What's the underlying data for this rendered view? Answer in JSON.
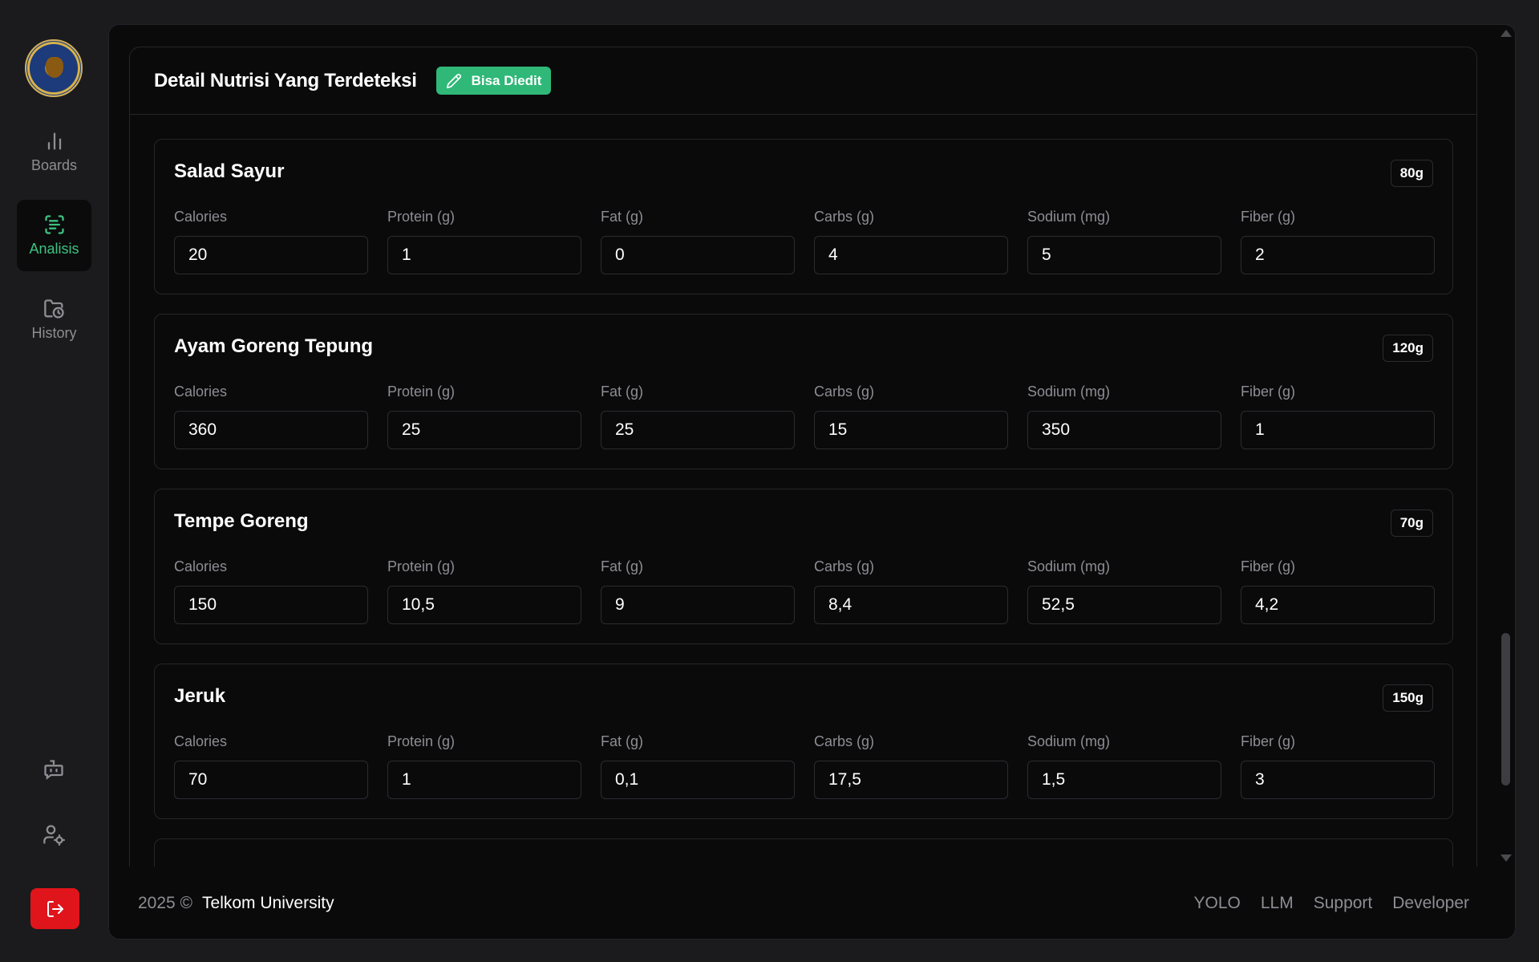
{
  "sidebar": {
    "nav": [
      {
        "label": "Boards",
        "icon": "bar-chart-icon"
      },
      {
        "label": "Analisis",
        "icon": "scan-text-icon"
      },
      {
        "label": "History",
        "icon": "folder-clock-icon"
      }
    ],
    "accent_color": "#3ec27f",
    "logout_color": "#e0151b"
  },
  "card": {
    "title": "Detail Nutrisi Yang Terdeteksi",
    "badge": "Bisa Diedit"
  },
  "labels": {
    "calories": "Calories",
    "protein": "Protein (g)",
    "fat": "Fat (g)",
    "carbs": "Carbs (g)",
    "sodium": "Sodium (mg)",
    "fiber": "Fiber (g)"
  },
  "foods": [
    {
      "name": "Salad Sayur",
      "weight": "80g",
      "calories": "20",
      "protein": "1",
      "fat": "0",
      "carbs": "4",
      "sodium": "5",
      "fiber": "2"
    },
    {
      "name": "Ayam Goreng Tepung",
      "weight": "120g",
      "calories": "360",
      "protein": "25",
      "fat": "25",
      "carbs": "15",
      "sodium": "350",
      "fiber": "1"
    },
    {
      "name": "Tempe Goreng",
      "weight": "70g",
      "calories": "150",
      "protein": "10,5",
      "fat": "9",
      "carbs": "8,4",
      "sodium": "52,5",
      "fiber": "4,2"
    },
    {
      "name": "Jeruk",
      "weight": "150g",
      "calories": "70",
      "protein": "1",
      "fat": "0,1",
      "carbs": "17,5",
      "sodium": "1,5",
      "fiber": "3"
    }
  ],
  "footer": {
    "year": "2025 ©",
    "org": "Telkom University",
    "links": [
      "YOLO",
      "LLM",
      "Support",
      "Developer"
    ]
  }
}
